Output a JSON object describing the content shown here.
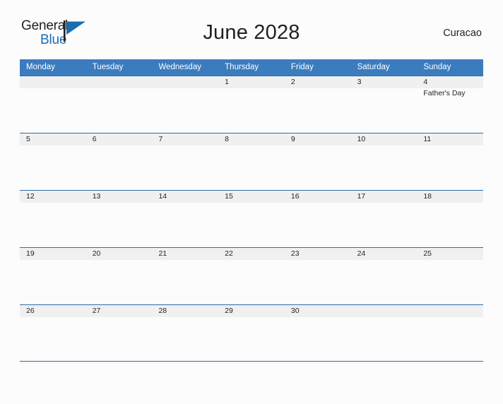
{
  "header": {
    "logo": {
      "word_one": "General",
      "word_two": "Blue",
      "flag_icon": "general-blue-flag-icon",
      "accent_color": "#1b6cb0"
    },
    "title": "June 2028",
    "region": "Curacao"
  },
  "calendar": {
    "month": "June",
    "year": "2028",
    "header_color": "#3a7cbe",
    "band_color": "#f0f0f0",
    "weekdays": [
      "Monday",
      "Tuesday",
      "Wednesday",
      "Thursday",
      "Friday",
      "Saturday",
      "Sunday"
    ],
    "weeks": [
      [
        {
          "day": "",
          "event": ""
        },
        {
          "day": "",
          "event": ""
        },
        {
          "day": "",
          "event": ""
        },
        {
          "day": "1",
          "event": ""
        },
        {
          "day": "2",
          "event": ""
        },
        {
          "day": "3",
          "event": ""
        },
        {
          "day": "4",
          "event": "Father's Day"
        }
      ],
      [
        {
          "day": "5",
          "event": ""
        },
        {
          "day": "6",
          "event": ""
        },
        {
          "day": "7",
          "event": ""
        },
        {
          "day": "8",
          "event": ""
        },
        {
          "day": "9",
          "event": ""
        },
        {
          "day": "10",
          "event": ""
        },
        {
          "day": "11",
          "event": ""
        }
      ],
      [
        {
          "day": "12",
          "event": ""
        },
        {
          "day": "13",
          "event": ""
        },
        {
          "day": "14",
          "event": ""
        },
        {
          "day": "15",
          "event": ""
        },
        {
          "day": "16",
          "event": ""
        },
        {
          "day": "17",
          "event": ""
        },
        {
          "day": "18",
          "event": ""
        }
      ],
      [
        {
          "day": "19",
          "event": ""
        },
        {
          "day": "20",
          "event": ""
        },
        {
          "day": "21",
          "event": ""
        },
        {
          "day": "22",
          "event": ""
        },
        {
          "day": "23",
          "event": ""
        },
        {
          "day": "24",
          "event": ""
        },
        {
          "day": "25",
          "event": ""
        }
      ],
      [
        {
          "day": "26",
          "event": ""
        },
        {
          "day": "27",
          "event": ""
        },
        {
          "day": "28",
          "event": ""
        },
        {
          "day": "29",
          "event": ""
        },
        {
          "day": "30",
          "event": ""
        },
        {
          "day": "",
          "event": ""
        },
        {
          "day": "",
          "event": ""
        }
      ]
    ]
  }
}
